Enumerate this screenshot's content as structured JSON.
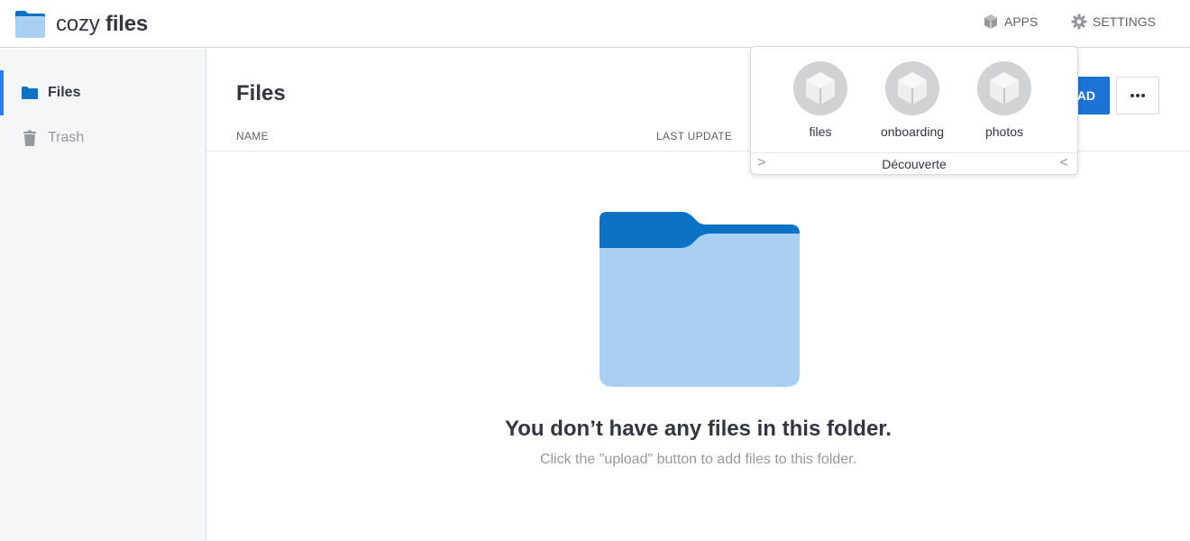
{
  "header": {
    "brand_light": "cozy",
    "brand_bold": "files",
    "apps_label": "APPS",
    "settings_label": "SETTINGS"
  },
  "sidebar": {
    "items": [
      {
        "label": "Files",
        "icon": "folder-icon",
        "active": true
      },
      {
        "label": "Trash",
        "icon": "trash-icon",
        "active": false
      }
    ]
  },
  "main": {
    "title": "Files",
    "columns": [
      "NAME",
      "LAST UPDATE"
    ],
    "upload_label": "AD",
    "more_icon": "more-dots-icon",
    "empty_title": "You don’t have any files in this folder.",
    "empty_subtitle": "Click the \"upload\" button to add files to this folder."
  },
  "apps_popover": {
    "apps": [
      {
        "label": "files",
        "icon": "cube-icon"
      },
      {
        "label": "onboarding",
        "icon": "cube-icon"
      },
      {
        "label": "photos",
        "icon": "cube-icon"
      }
    ],
    "footer_label": "Découverte",
    "prev_arrow": ">",
    "next_arrow": "<"
  },
  "colors": {
    "accent": "#297ef2",
    "folder_dark": "#0c73c4",
    "folder_light": "#a9d0f2",
    "sidebar_bg": "#f5f6f7",
    "text": "#32363f",
    "muted": "#95999d"
  }
}
